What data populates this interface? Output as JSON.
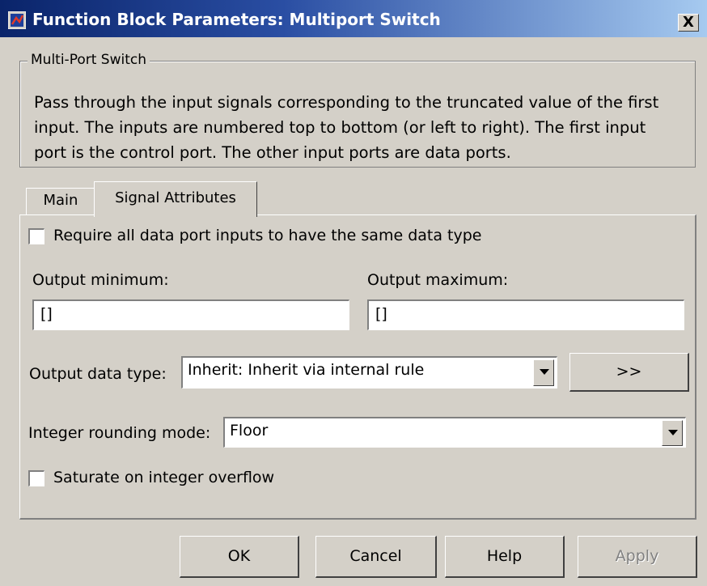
{
  "window": {
    "title": "Function Block Parameters: Multiport Switch",
    "close_label": "X"
  },
  "group": {
    "legend": "Multi-Port Switch",
    "description": "Pass through the input signals corresponding to the truncated value of the first input. The inputs are numbered top to bottom (or left to right). The first input port is the control port. The other input ports are data ports."
  },
  "tabs": [
    {
      "label": "Main",
      "selected": false
    },
    {
      "label": "Signal Attributes",
      "selected": true
    }
  ],
  "signal_attributes": {
    "require_same_type": {
      "label": "Require all data port inputs to have the same data type",
      "checked": false
    },
    "output_minimum": {
      "label": "Output minimum:",
      "value": "[]"
    },
    "output_maximum": {
      "label": "Output maximum:",
      "value": "[]"
    },
    "output_data_type": {
      "label": "Output data type:",
      "value": "Inherit: Inherit via internal rule",
      "assistant_label": ">>"
    },
    "integer_rounding_mode": {
      "label": "Integer rounding mode:",
      "value": "Floor"
    },
    "saturate_overflow": {
      "label": "Saturate on integer overflow",
      "checked": false
    }
  },
  "buttons": {
    "ok": "OK",
    "cancel": "Cancel",
    "help": "Help",
    "apply": "Apply"
  }
}
